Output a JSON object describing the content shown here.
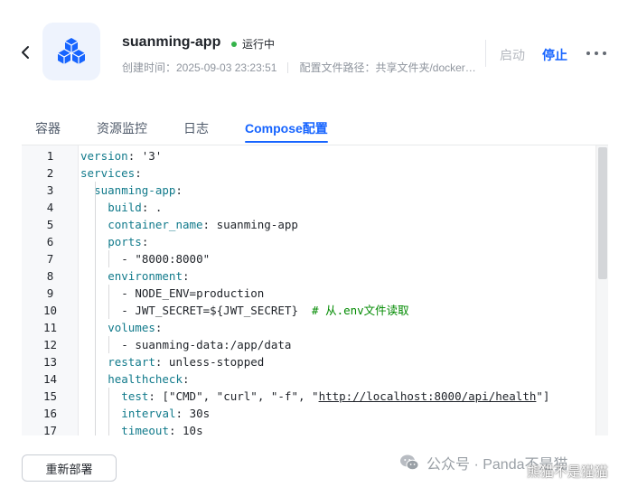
{
  "app": {
    "name": "suanming-app",
    "status": "运行中",
    "created": "创建时间：2025-09-03 23:23:51",
    "config_path": "配置文件路径：共享文件夹/docker/suanming-app/docker-compose.yml",
    "icon": "blocks-icon"
  },
  "actions": {
    "start": "启动",
    "stop": "停止"
  },
  "colors": {
    "accent": "#1664ff",
    "status_running": "#35b34a"
  },
  "tabs": [
    {
      "label": "容器"
    },
    {
      "label": "资源监控"
    },
    {
      "label": "日志"
    },
    {
      "label": "Compose配置"
    }
  ],
  "active_tab": "Compose配置",
  "editor": {
    "lines": [
      {
        "n": "1",
        "indent": 0,
        "key": "version",
        "rest": ": '3'"
      },
      {
        "n": "2",
        "indent": 0,
        "key": "services",
        "rest": ":"
      },
      {
        "n": "3",
        "indent": 2,
        "key": "suanming-app",
        "rest": ":"
      },
      {
        "n": "4",
        "indent": 4,
        "key": "build",
        "rest": ": ."
      },
      {
        "n": "5",
        "indent": 4,
        "key": "container_name",
        "rest": ": suanming-app"
      },
      {
        "n": "6",
        "indent": 4,
        "key": "ports",
        "rest": ":"
      },
      {
        "n": "7",
        "indent": 6,
        "key": "",
        "rest": "- \"8000:8000\""
      },
      {
        "n": "8",
        "indent": 4,
        "key": "environment",
        "rest": ":"
      },
      {
        "n": "9",
        "indent": 6,
        "key": "",
        "rest": "- NODE_ENV=production"
      },
      {
        "n": "10",
        "indent": 6,
        "key": "",
        "rest": "- JWT_SECRET=${JWT_SECRET}  ",
        "comment": "# 从.env文件读取"
      },
      {
        "n": "11",
        "indent": 4,
        "key": "volumes",
        "rest": ":"
      },
      {
        "n": "12",
        "indent": 6,
        "key": "",
        "rest": "- suanming-data:/app/data"
      },
      {
        "n": "13",
        "indent": 4,
        "key": "restart",
        "rest": ": unless-stopped"
      },
      {
        "n": "14",
        "indent": 4,
        "key": "healthcheck",
        "rest": ":"
      },
      {
        "n": "15",
        "indent": 6,
        "key": "test",
        "rest": ": [\"CMD\", \"curl\", \"-f\", \"",
        "url": "http://localhost:8000/api/health",
        "tail": "\"]"
      },
      {
        "n": "16",
        "indent": 6,
        "key": "interval",
        "rest": ": 30s"
      },
      {
        "n": "17",
        "indent": 6,
        "key": "timeout",
        "rest": ": 10s"
      }
    ]
  },
  "footer": {
    "redeploy": "重新部署"
  },
  "watermark": {
    "text": "公众号 · Panda不是猫",
    "overlay": "熊猫不是猫猫"
  }
}
